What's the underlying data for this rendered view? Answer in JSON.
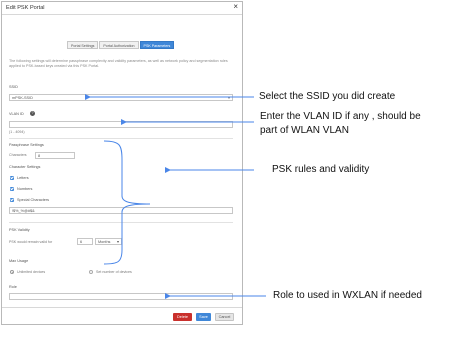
{
  "dialog": {
    "title": "Edit PSK Portal",
    "close_glyph": "×",
    "tabs": [
      {
        "label": "Portal Settings",
        "active": false
      },
      {
        "label": "Portal Authorization",
        "active": false
      },
      {
        "label": "PSK Parameters",
        "active": true
      }
    ],
    "intro": "The following settings will determine passphrase complexity and validity parameters, as well as network policy and segmentation rules applied to PSK-based keys created via this PSK Portal.",
    "ssid": {
      "label": "SSID",
      "value": "mPSK-SSID"
    },
    "vlan": {
      "label": "VLAN ID",
      "value": "",
      "hint": "(1 - 4094)"
    },
    "passphrase": {
      "heading": "Passphrase Settings",
      "characters_label": "Characters",
      "characters_value": "8"
    },
    "character_settings": {
      "heading": "Character Settings",
      "letters": "Letters",
      "numbers": "Numbers",
      "special": "Special Characters",
      "special_value": "!$%_%@#$&"
    },
    "validity": {
      "heading": "PSK Validity",
      "text": "PSK would remain valid for",
      "value": "6",
      "unit": "Months"
    },
    "max_usage": {
      "heading": "Max Usage",
      "unlimited": "Unlimited devices",
      "set_number": "Set number of devices"
    },
    "role": {
      "label": "Role",
      "value": ""
    },
    "buttons": {
      "delete": "Delete",
      "save": "Save",
      "cancel": "Cancel"
    }
  },
  "annotations": {
    "ssid": "Select the SSID you did create",
    "vlan_line1": "Enter the VLAN ID if any , should be",
    "vlan_line2": "part of WLAN VLAN",
    "psk": "PSK rules and validity",
    "role": "Role to used in WXLAN if needed"
  },
  "colors": {
    "accent": "#3f87d8",
    "delete": "#c9302c",
    "bracket": "#4a86e8"
  },
  "icons": [
    "close-icon",
    "help-icon",
    "checkbox-checked-icon",
    "radio-icon",
    "dropdown-caret-icon"
  ]
}
